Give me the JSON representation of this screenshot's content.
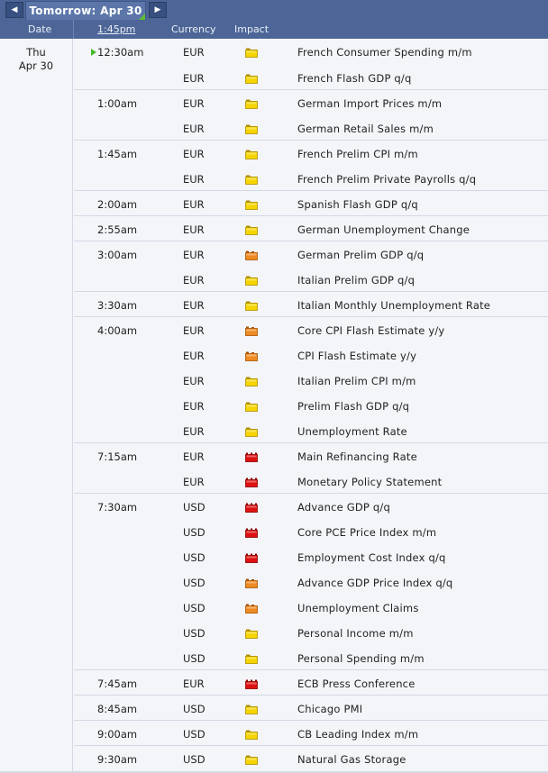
{
  "nav": {
    "day_label": "Tomorrow: Apr 30"
  },
  "header": {
    "date": "Date",
    "time": "1:45pm",
    "currency": "Currency",
    "impact": "Impact"
  },
  "date_cell": {
    "weekday": "Thu",
    "date": "Apr 30"
  },
  "impact_colors": {
    "low": "#f5d400",
    "medium": "#ee8a22",
    "high": "#dd1111"
  },
  "events": [
    {
      "time": "12:30am",
      "currency": "EUR",
      "impact": "low",
      "title": "French Consumer Spending m/m",
      "current": true
    },
    {
      "time": "",
      "currency": "EUR",
      "impact": "low",
      "title": "French Flash GDP q/q"
    },
    {
      "time": "1:00am",
      "currency": "EUR",
      "impact": "low",
      "title": "German Import Prices m/m"
    },
    {
      "time": "",
      "currency": "EUR",
      "impact": "low",
      "title": "German Retail Sales m/m"
    },
    {
      "time": "1:45am",
      "currency": "EUR",
      "impact": "low",
      "title": "French Prelim CPI m/m"
    },
    {
      "time": "",
      "currency": "EUR",
      "impact": "low",
      "title": "French Prelim Private Payrolls q/q"
    },
    {
      "time": "2:00am",
      "currency": "EUR",
      "impact": "low",
      "title": "Spanish Flash GDP q/q"
    },
    {
      "time": "2:55am",
      "currency": "EUR",
      "impact": "low",
      "title": "German Unemployment Change"
    },
    {
      "time": "3:00am",
      "currency": "EUR",
      "impact": "medium",
      "title": "German Prelim GDP q/q"
    },
    {
      "time": "",
      "currency": "EUR",
      "impact": "low",
      "title": "Italian Prelim GDP q/q"
    },
    {
      "time": "3:30am",
      "currency": "EUR",
      "impact": "low",
      "title": "Italian Monthly Unemployment Rate"
    },
    {
      "time": "4:00am",
      "currency": "EUR",
      "impact": "medium",
      "title": "Core CPI Flash Estimate y/y"
    },
    {
      "time": "",
      "currency": "EUR",
      "impact": "medium",
      "title": "CPI Flash Estimate y/y"
    },
    {
      "time": "",
      "currency": "EUR",
      "impact": "low",
      "title": "Italian Prelim CPI m/m"
    },
    {
      "time": "",
      "currency": "EUR",
      "impact": "low",
      "title": "Prelim Flash GDP q/q"
    },
    {
      "time": "",
      "currency": "EUR",
      "impact": "low",
      "title": "Unemployment Rate"
    },
    {
      "time": "7:15am",
      "currency": "EUR",
      "impact": "high",
      "title": "Main Refinancing Rate"
    },
    {
      "time": "",
      "currency": "EUR",
      "impact": "high",
      "title": "Monetary Policy Statement"
    },
    {
      "time": "7:30am",
      "currency": "USD",
      "impact": "high",
      "title": "Advance GDP q/q"
    },
    {
      "time": "",
      "currency": "USD",
      "impact": "high",
      "title": "Core PCE Price Index m/m"
    },
    {
      "time": "",
      "currency": "USD",
      "impact": "high",
      "title": "Employment Cost Index q/q"
    },
    {
      "time": "",
      "currency": "USD",
      "impact": "medium",
      "title": "Advance GDP Price Index q/q"
    },
    {
      "time": "",
      "currency": "USD",
      "impact": "medium",
      "title": "Unemployment Claims"
    },
    {
      "time": "",
      "currency": "USD",
      "impact": "low",
      "title": "Personal Income m/m"
    },
    {
      "time": "",
      "currency": "USD",
      "impact": "low",
      "title": "Personal Spending m/m"
    },
    {
      "time": "7:45am",
      "currency": "EUR",
      "impact": "high",
      "title": "ECB Press Conference"
    },
    {
      "time": "8:45am",
      "currency": "USD",
      "impact": "low",
      "title": "Chicago PMI"
    },
    {
      "time": "9:00am",
      "currency": "USD",
      "impact": "low",
      "title": "CB Leading Index m/m"
    },
    {
      "time": "9:30am",
      "currency": "USD",
      "impact": "low",
      "title": "Natural Gas Storage"
    }
  ]
}
